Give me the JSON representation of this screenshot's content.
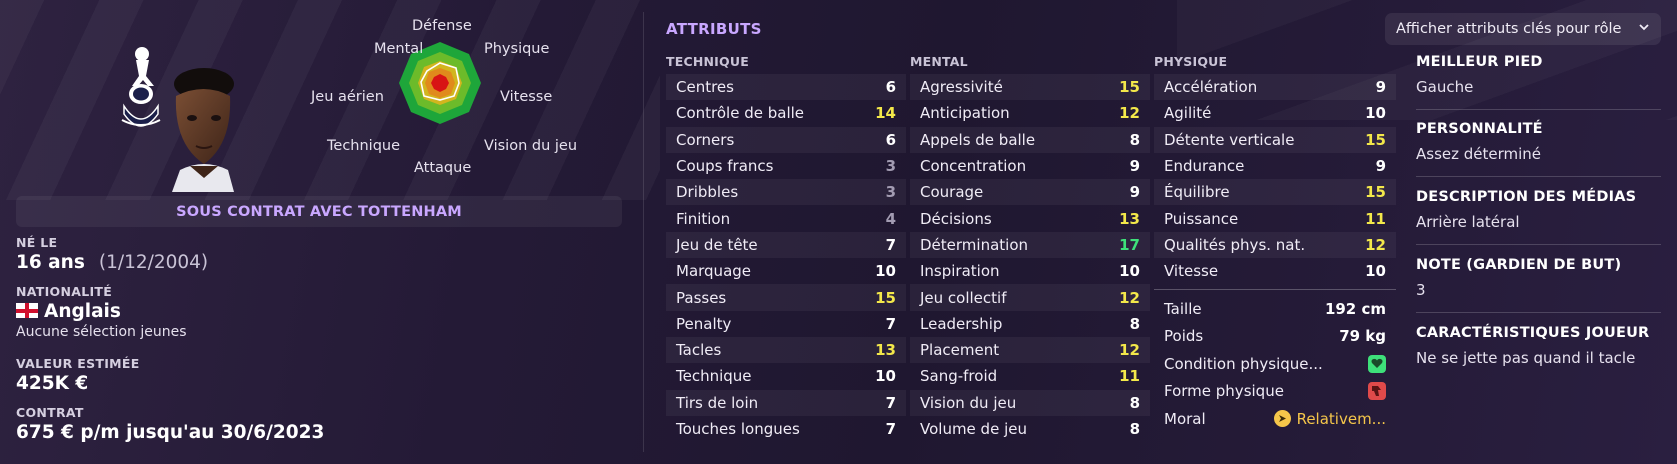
{
  "radar": {
    "labels": {
      "top": "Défense",
      "top_right": "Physique",
      "right": "Vitesse",
      "bottom_right": "Vision du jeu",
      "bottom": "Attaque",
      "bottom_left": "Technique",
      "left": "Jeu aérien",
      "top_left": "Mental"
    }
  },
  "profile": {
    "contract_banner": "SOUS CONTRAT AVEC TOTTENHAM",
    "born_label": "NÉ LE",
    "age": "16 ans",
    "birthdate": "(1/12/2004)",
    "nationality_label": "NATIONALITÉ",
    "nationality": "Anglais",
    "caps": "Aucune sélection jeunes",
    "value_label": "VALEUR ESTIMÉE",
    "value": "425K €",
    "contract_label": "CONTRAT",
    "contract": "675 € p/m jusqu'au 30/6/2023"
  },
  "attributes": {
    "title": "ATTRIBUTS",
    "role_button": "Afficher attributs clés pour rôle",
    "technique": {
      "heading": "TECHNIQUE",
      "items": [
        {
          "name": "Centres",
          "value": "6",
          "tone": "w"
        },
        {
          "name": "Contrôle de balle",
          "value": "14",
          "tone": "y"
        },
        {
          "name": "Corners",
          "value": "6",
          "tone": "w"
        },
        {
          "name": "Coups francs",
          "value": "3",
          "tone": "g"
        },
        {
          "name": "Dribbles",
          "value": "3",
          "tone": "g"
        },
        {
          "name": "Finition",
          "value": "4",
          "tone": "g"
        },
        {
          "name": "Jeu de tête",
          "value": "7",
          "tone": "w"
        },
        {
          "name": "Marquage",
          "value": "10",
          "tone": "w"
        },
        {
          "name": "Passes",
          "value": "15",
          "tone": "y"
        },
        {
          "name": "Penalty",
          "value": "7",
          "tone": "w"
        },
        {
          "name": "Tacles",
          "value": "13",
          "tone": "y"
        },
        {
          "name": "Technique",
          "value": "10",
          "tone": "w"
        },
        {
          "name": "Tirs de loin",
          "value": "7",
          "tone": "w"
        },
        {
          "name": "Touches longues",
          "value": "7",
          "tone": "w"
        }
      ]
    },
    "mental": {
      "heading": "MENTAL",
      "items": [
        {
          "name": "Agressivité",
          "value": "15",
          "tone": "y"
        },
        {
          "name": "Anticipation",
          "value": "12",
          "tone": "y"
        },
        {
          "name": "Appels de balle",
          "value": "8",
          "tone": "w"
        },
        {
          "name": "Concentration",
          "value": "9",
          "tone": "w"
        },
        {
          "name": "Courage",
          "value": "9",
          "tone": "w"
        },
        {
          "name": "Décisions",
          "value": "13",
          "tone": "y"
        },
        {
          "name": "Détermination",
          "value": "17",
          "tone": "gr"
        },
        {
          "name": "Inspiration",
          "value": "10",
          "tone": "w"
        },
        {
          "name": "Jeu collectif",
          "value": "12",
          "tone": "y"
        },
        {
          "name": "Leadership",
          "value": "8",
          "tone": "w"
        },
        {
          "name": "Placement",
          "value": "12",
          "tone": "y"
        },
        {
          "name": "Sang-froid",
          "value": "11",
          "tone": "y"
        },
        {
          "name": "Vision du jeu",
          "value": "8",
          "tone": "w"
        },
        {
          "name": "Volume de jeu",
          "value": "8",
          "tone": "w"
        }
      ]
    },
    "physique": {
      "heading": "PHYSIQUE",
      "items": [
        {
          "name": "Accélération",
          "value": "9",
          "tone": "w"
        },
        {
          "name": "Agilité",
          "value": "10",
          "tone": "w"
        },
        {
          "name": "Détente verticale",
          "value": "15",
          "tone": "y"
        },
        {
          "name": "Endurance",
          "value": "9",
          "tone": "w"
        },
        {
          "name": "Équilibre",
          "value": "15",
          "tone": "y"
        },
        {
          "name": "Puissance",
          "value": "11",
          "tone": "y"
        },
        {
          "name": "Qualités phys. nat.",
          "value": "12",
          "tone": "y"
        },
        {
          "name": "Vitesse",
          "value": "10",
          "tone": "w"
        }
      ]
    },
    "extra": {
      "height_label": "Taille",
      "height": "192 cm",
      "weight_label": "Poids",
      "weight": "79 kg",
      "condition_label": "Condition physique...",
      "form_label": "Forme physique",
      "morale_label": "Moral",
      "morale": "Relativem..."
    }
  },
  "details": {
    "foot_label": "MEILLEUR PIED",
    "foot": "Gauche",
    "personality_label": "PERSONNALITÉ",
    "personality": "Assez déterminé",
    "media_label": "DESCRIPTION DES MÉDIAS",
    "media": "Arrière latéral",
    "gk_label": "NOTE (GARDIEN DE BUT)",
    "gk": "3",
    "traits_label": "CARACTÉRISTIQUES JOUEUR",
    "traits": "Ne se jette pas quand il tacle"
  },
  "colors": {
    "accent": "#c9a7ff",
    "attr_high": "#f3e84a",
    "attr_top": "#3ee07a",
    "attr_low": "#a39cb2",
    "morale": "#f5c64a"
  }
}
